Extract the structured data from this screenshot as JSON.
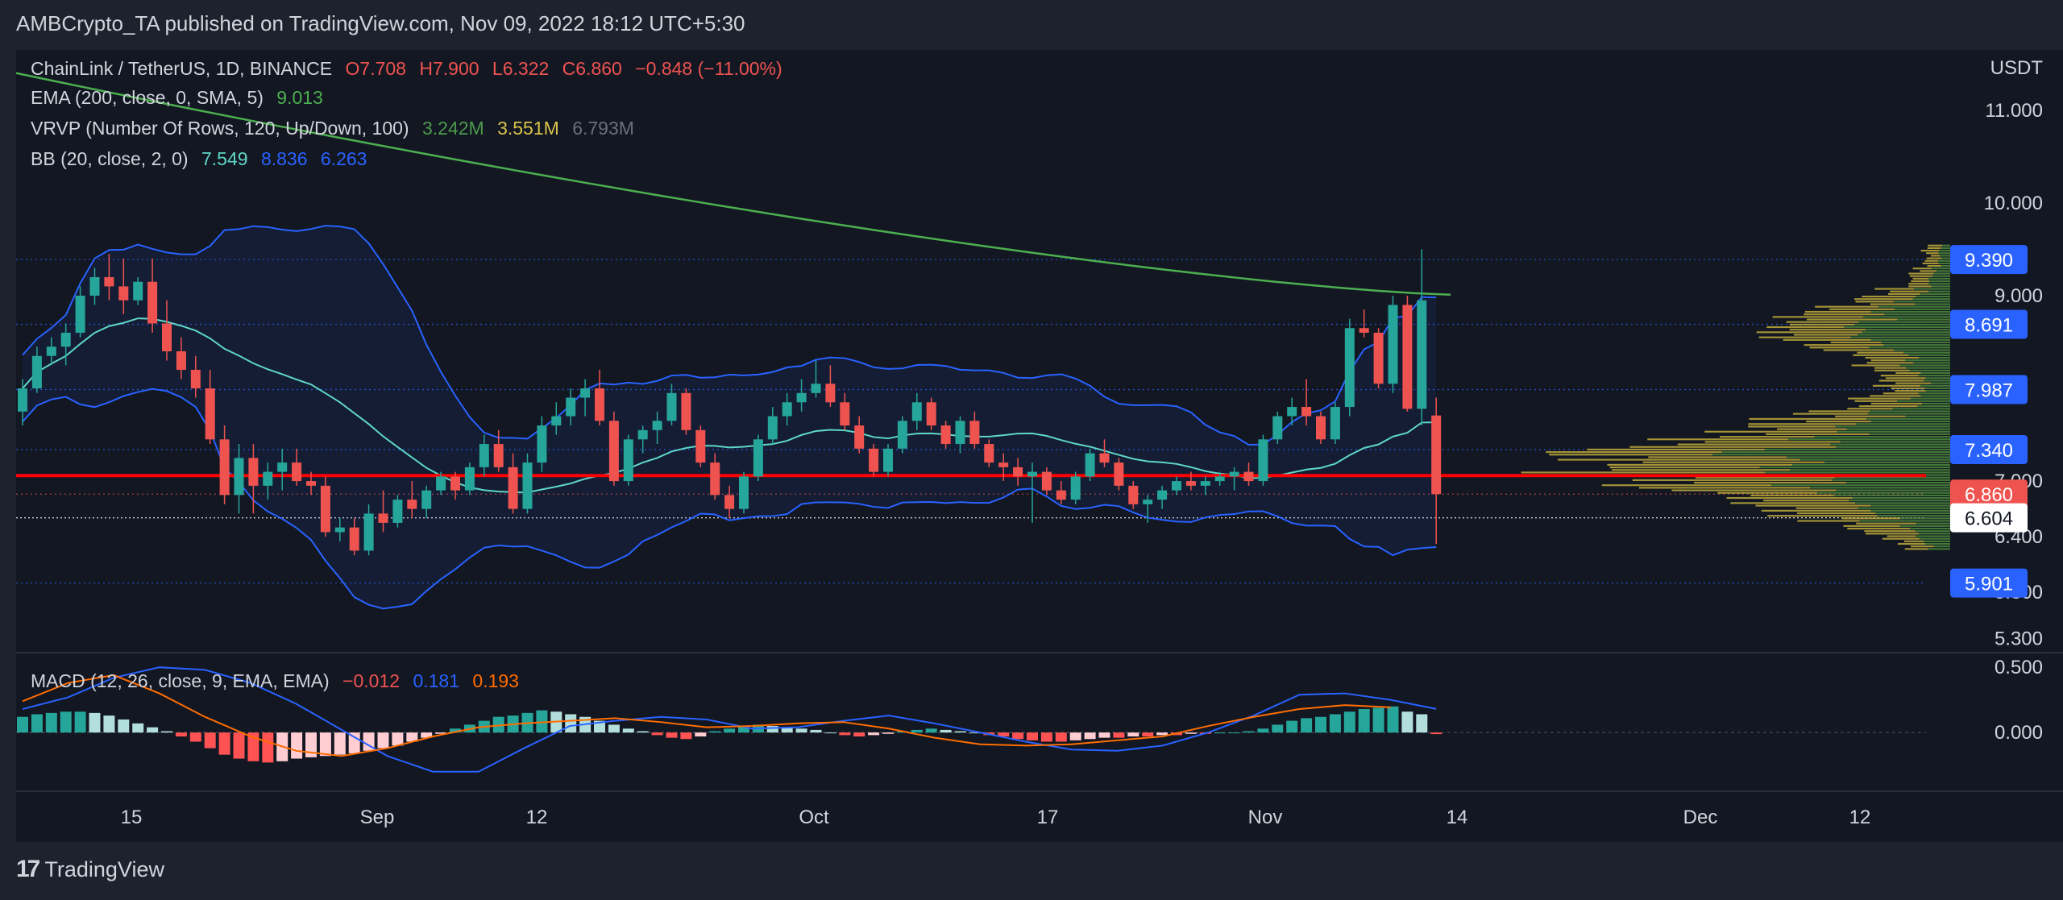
{
  "header": {
    "publisher": "AMBCrypto_TA published on TradingView.com, Nov 09, 2022 18:12 UTC+5:30"
  },
  "legend": {
    "symbol": "ChainLink / TetherUS, 1D, BINANCE",
    "o": "O7.708",
    "h": "H7.900",
    "l": "L6.322",
    "c": "C6.860",
    "change": "−0.848 (−11.00%)",
    "ema_label": "EMA (200, close, 0, SMA, 5)",
    "ema_value": "9.013",
    "vrvp_label": "VRVP (Number Of Rows, 120, Up/Down, 100)",
    "vrvp_up": "3.242M",
    "vrvp_down": "3.551M",
    "vrvp_total": "6.793M",
    "bb_label": "BB (20, close, 2, 0)",
    "bb_basis": "7.549",
    "bb_upper": "8.836",
    "bb_lower": "6.263",
    "macd_label": "MACD (12, 26, close, 9, EMA, EMA)",
    "macd_hist": "−0.012",
    "macd_line": "0.181",
    "macd_signal": "0.193"
  },
  "footer": {
    "brand": "TradingView",
    "logo": "tradingview-logo-icon"
  },
  "colors": {
    "up": "#26a69a",
    "down": "#ef5350",
    "ema": "#4caf50",
    "bb_line": "#2962ff",
    "bb_basis": "#5ed6c8",
    "macd_line": "#2962ff",
    "signal": "#ff6d00",
    "support": "#ff0000",
    "vp_up": "#4c8a3c",
    "vp_down": "#c9b43c"
  },
  "chart_data": {
    "type": "candlestick",
    "currency": "USDT",
    "x_ticks": [
      "15",
      "Sep",
      "12",
      "Oct",
      "17",
      "Nov",
      "14",
      "Dec",
      "12"
    ],
    "y_ticks": [
      "11.000",
      "10.000",
      "9.000",
      "7.000",
      "6.400",
      "5.800",
      "5.300"
    ],
    "ylim": [
      5.15,
      11.65
    ],
    "price_marks": [
      {
        "value": 9.39,
        "label": "9.390",
        "color": "#2962ff"
      },
      {
        "value": 8.691,
        "label": "8.691",
        "color": "#2962ff"
      },
      {
        "value": 7.987,
        "label": "7.987",
        "color": "#2962ff"
      },
      {
        "value": 7.34,
        "label": "7.340",
        "color": "#2962ff"
      },
      {
        "value": 6.86,
        "label": "6.860",
        "color": "#ef5350"
      },
      {
        "value": 6.604,
        "label": "6.604",
        "color": "#ffffff"
      },
      {
        "value": 5.901,
        "label": "5.901",
        "color": "#2962ff"
      }
    ],
    "support_level": 7.06,
    "candles": [
      [
        7.75,
        8.1,
        7.6,
        8.0
      ],
      [
        8.0,
        8.45,
        7.95,
        8.35
      ],
      [
        8.35,
        8.55,
        8.25,
        8.45
      ],
      [
        8.45,
        8.7,
        8.25,
        8.6
      ],
      [
        8.6,
        9.1,
        8.55,
        9.0
      ],
      [
        9.0,
        9.3,
        8.9,
        9.2
      ],
      [
        9.2,
        9.45,
        8.95,
        9.1
      ],
      [
        9.1,
        9.4,
        8.8,
        8.95
      ],
      [
        8.95,
        9.2,
        8.9,
        9.15
      ],
      [
        9.15,
        9.4,
        8.6,
        8.7
      ],
      [
        8.7,
        8.95,
        8.3,
        8.4
      ],
      [
        8.4,
        8.55,
        8.1,
        8.2
      ],
      [
        8.2,
        8.35,
        7.9,
        8.0
      ],
      [
        8.0,
        8.2,
        7.4,
        7.45
      ],
      [
        7.45,
        7.6,
        6.75,
        6.85
      ],
      [
        6.85,
        7.4,
        6.65,
        7.25
      ],
      [
        7.25,
        7.4,
        6.65,
        6.95
      ],
      [
        6.95,
        7.2,
        6.8,
        7.1
      ],
      [
        7.1,
        7.35,
        6.9,
        7.2
      ],
      [
        7.2,
        7.35,
        6.95,
        7.0
      ],
      [
        7.0,
        7.1,
        6.85,
        6.95
      ],
      [
        6.95,
        7.05,
        6.4,
        6.45
      ],
      [
        6.45,
        6.6,
        6.35,
        6.5
      ],
      [
        6.5,
        6.6,
        6.2,
        6.25
      ],
      [
        6.25,
        6.75,
        6.2,
        6.65
      ],
      [
        6.65,
        6.9,
        6.45,
        6.55
      ],
      [
        6.55,
        6.85,
        6.5,
        6.8
      ],
      [
        6.8,
        7.0,
        6.6,
        6.7
      ],
      [
        6.7,
        6.95,
        6.6,
        6.9
      ],
      [
        6.9,
        7.1,
        6.85,
        7.05
      ],
      [
        7.05,
        7.1,
        6.8,
        6.9
      ],
      [
        6.9,
        7.2,
        6.85,
        7.15
      ],
      [
        7.15,
        7.5,
        7.05,
        7.4
      ],
      [
        7.4,
        7.55,
        7.1,
        7.15
      ],
      [
        7.15,
        7.3,
        6.65,
        6.7
      ],
      [
        6.7,
        7.3,
        6.65,
        7.2
      ],
      [
        7.2,
        7.7,
        7.1,
        7.6
      ],
      [
        7.6,
        7.85,
        7.5,
        7.7
      ],
      [
        7.7,
        8.0,
        7.6,
        7.9
      ],
      [
        7.9,
        8.1,
        7.7,
        8.0
      ],
      [
        8.0,
        8.2,
        7.6,
        7.65
      ],
      [
        7.65,
        7.75,
        6.95,
        7.0
      ],
      [
        7.0,
        7.5,
        6.95,
        7.45
      ],
      [
        7.45,
        7.6,
        7.3,
        7.55
      ],
      [
        7.55,
        7.75,
        7.4,
        7.65
      ],
      [
        7.65,
        8.05,
        7.6,
        7.95
      ],
      [
        7.95,
        8.0,
        7.5,
        7.55
      ],
      [
        7.55,
        7.6,
        7.15,
        7.2
      ],
      [
        7.2,
        7.3,
        6.8,
        6.85
      ],
      [
        6.85,
        6.95,
        6.6,
        6.7
      ],
      [
        6.7,
        7.1,
        6.65,
        7.05
      ],
      [
        7.05,
        7.5,
        7.0,
        7.45
      ],
      [
        7.45,
        7.8,
        7.4,
        7.7
      ],
      [
        7.7,
        7.95,
        7.6,
        7.85
      ],
      [
        7.85,
        8.1,
        7.75,
        7.95
      ],
      [
        7.95,
        8.3,
        7.9,
        8.05
      ],
      [
        8.05,
        8.25,
        7.8,
        7.85
      ],
      [
        7.85,
        7.95,
        7.55,
        7.6
      ],
      [
        7.6,
        7.7,
        7.3,
        7.35
      ],
      [
        7.35,
        7.4,
        7.05,
        7.1
      ],
      [
        7.1,
        7.4,
        7.05,
        7.35
      ],
      [
        7.35,
        7.7,
        7.3,
        7.65
      ],
      [
        7.65,
        7.95,
        7.55,
        7.85
      ],
      [
        7.85,
        7.9,
        7.55,
        7.6
      ],
      [
        7.6,
        7.65,
        7.35,
        7.4
      ],
      [
        7.4,
        7.7,
        7.3,
        7.65
      ],
      [
        7.65,
        7.75,
        7.35,
        7.4
      ],
      [
        7.4,
        7.45,
        7.15,
        7.2
      ],
      [
        7.2,
        7.3,
        7.0,
        7.15
      ],
      [
        7.15,
        7.25,
        6.95,
        7.05
      ],
      [
        7.05,
        7.2,
        6.55,
        7.1
      ],
      [
        7.1,
        7.15,
        6.85,
        6.9
      ],
      [
        6.9,
        7.0,
        6.75,
        6.8
      ],
      [
        6.8,
        7.1,
        6.75,
        7.05
      ],
      [
        7.05,
        7.35,
        7.0,
        7.3
      ],
      [
        7.3,
        7.45,
        7.15,
        7.2
      ],
      [
        7.2,
        7.25,
        6.9,
        6.95
      ],
      [
        6.95,
        7.0,
        6.7,
        6.75
      ],
      [
        6.75,
        6.85,
        6.55,
        6.8
      ],
      [
        6.8,
        6.95,
        6.7,
        6.9
      ],
      [
        6.9,
        7.05,
        6.85,
        7.0
      ],
      [
        7.0,
        7.1,
        6.9,
        6.95
      ],
      [
        6.95,
        7.05,
        6.85,
        7.0
      ],
      [
        7.0,
        7.1,
        6.95,
        7.05
      ],
      [
        7.05,
        7.15,
        6.9,
        7.1
      ],
      [
        7.1,
        7.2,
        6.95,
        7.0
      ],
      [
        7.0,
        7.5,
        6.95,
        7.45
      ],
      [
        7.45,
        7.75,
        7.4,
        7.7
      ],
      [
        7.7,
        7.9,
        7.6,
        7.8
      ],
      [
        7.8,
        8.1,
        7.6,
        7.7
      ],
      [
        7.7,
        7.75,
        7.4,
        7.45
      ],
      [
        7.45,
        7.85,
        7.4,
        7.8
      ],
      [
        7.8,
        8.75,
        7.7,
        8.65
      ],
      [
        8.65,
        8.85,
        8.55,
        8.6
      ],
      [
        8.6,
        8.65,
        8.0,
        8.05
      ],
      [
        8.05,
        9.0,
        7.95,
        8.9
      ],
      [
        8.9,
        9.0,
        7.75,
        7.78
      ],
      [
        7.78,
        9.5,
        7.6,
        8.95
      ],
      [
        7.708,
        7.9,
        6.322,
        6.86
      ]
    ],
    "ema200_endpoints": [
      11.4,
      9.01
    ],
    "macd": {
      "ylim": [
        -0.45,
        0.6
      ],
      "y_ticks": [
        "0.500",
        "0.000"
      ],
      "histogram": [
        0.12,
        0.14,
        0.15,
        0.16,
        0.16,
        0.15,
        0.13,
        0.1,
        0.07,
        0.04,
        0.01,
        -0.03,
        -0.07,
        -0.12,
        -0.17,
        -0.2,
        -0.22,
        -0.23,
        -0.22,
        -0.2,
        -0.19,
        -0.18,
        -0.17,
        -0.16,
        -0.14,
        -0.12,
        -0.1,
        -0.07,
        -0.04,
        -0.01,
        0.03,
        0.06,
        0.09,
        0.12,
        0.13,
        0.15,
        0.17,
        0.16,
        0.14,
        0.12,
        0.09,
        0.06,
        0.03,
        0.01,
        -0.02,
        -0.04,
        -0.05,
        -0.03,
        0.01,
        0.03,
        0.05,
        0.06,
        0.05,
        0.04,
        0.03,
        0.02,
        0.0,
        -0.02,
        -0.03,
        -0.02,
        -0.01,
        0.01,
        0.02,
        0.03,
        0.02,
        0.01,
        0.0,
        -0.02,
        -0.03,
        -0.05,
        -0.06,
        -0.07,
        -0.07,
        -0.06,
        -0.05,
        -0.04,
        -0.04,
        -0.03,
        -0.03,
        -0.02,
        -0.02,
        -0.01,
        -0.01,
        0.0,
        0.0,
        0.01,
        0.03,
        0.06,
        0.09,
        0.11,
        0.12,
        0.14,
        0.16,
        0.18,
        0.19,
        0.2,
        0.16,
        0.14,
        -0.012
      ],
      "macd_line": [
        0.18,
        0.27,
        0.42,
        0.5,
        0.48,
        0.38,
        0.22,
        0.02,
        -0.18,
        -0.3,
        -0.3,
        -0.12,
        0.05,
        0.09,
        0.12,
        0.1,
        0.03,
        0.04,
        0.09,
        0.13,
        0.07,
        0.0,
        -0.07,
        -0.13,
        -0.14,
        -0.1,
        0.0,
        0.13,
        0.29,
        0.3,
        0.25,
        0.181
      ],
      "signal_line": [
        0.24,
        0.38,
        0.44,
        0.3,
        0.12,
        -0.03,
        -0.14,
        -0.18,
        -0.12,
        -0.03,
        0.04,
        0.07,
        0.09,
        0.11,
        0.08,
        0.04,
        0.05,
        0.07,
        0.08,
        0.03,
        -0.04,
        -0.09,
        -0.1,
        -0.09,
        -0.06,
        -0.03,
        0.05,
        0.12,
        0.18,
        0.21,
        0.193
      ]
    }
  }
}
